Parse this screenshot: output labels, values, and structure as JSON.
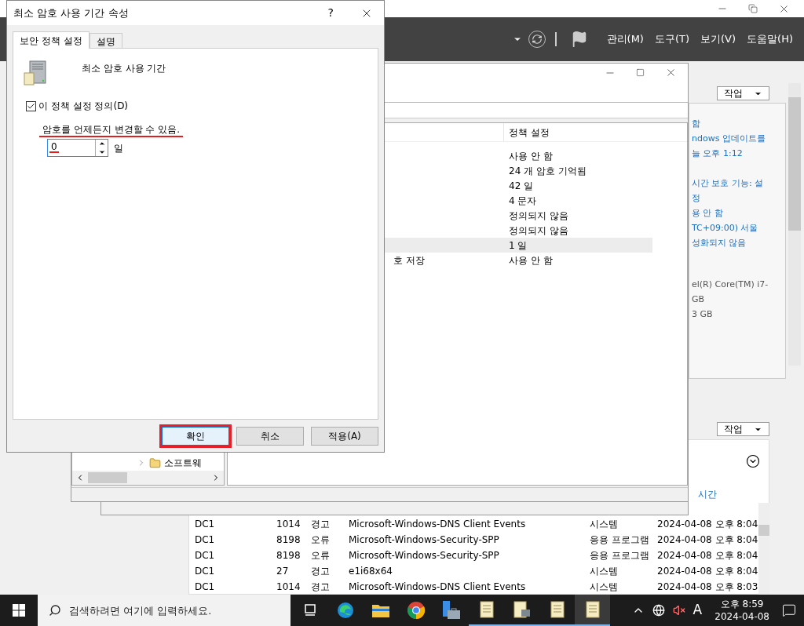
{
  "server_manager": {
    "menus": [
      "관리(M)",
      "도구(T)",
      "보기(V)",
      "도움말(H)"
    ],
    "properties_panel": {
      "task_button": "작업",
      "link_groups": [
        [
          "함",
          "ndows 업데이트를",
          "늘 오후 1:12"
        ],
        [
          "시간 보호 기능: 설",
          "정",
          "용 안 함",
          "TC+09:00) 서울",
          "성화되지 않음"
        ]
      ],
      "details": [
        "el(R) Core(TM) i7-",
        "GB",
        "3 GB"
      ]
    },
    "events_panel": {
      "task_button": "작업",
      "column_header": "시간",
      "rows": [
        {
          "server": "DC1",
          "id": "1014",
          "level": "경고",
          "source": "Microsoft-Windows-DNS Client Events",
          "log": "시스템",
          "date": "2024-04-08 오후 8:04"
        },
        {
          "server": "DC1",
          "id": "8198",
          "level": "오류",
          "source": "Microsoft-Windows-Security-SPP",
          "log": "응용 프로그램",
          "date": "2024-04-08 오후 8:04"
        },
        {
          "server": "DC1",
          "id": "8198",
          "level": "오류",
          "source": "Microsoft-Windows-Security-SPP",
          "log": "응용 프로그램",
          "date": "2024-04-08 오후 8:04"
        },
        {
          "server": "DC1",
          "id": "27",
          "level": "경고",
          "source": "e1i68x64",
          "log": "시스템",
          "date": "2024-04-08 오후 8:04"
        },
        {
          "server": "DC1",
          "id": "1014",
          "level": "경고",
          "source": "Microsoft-Windows-DNS Client Events",
          "log": "시스템",
          "date": "2024-04-08 오후 8:03"
        }
      ]
    }
  },
  "policy_window": {
    "tree_items": [
      {
        "label": "소프트웨",
        "expanded": false
      }
    ],
    "column_header": "정책 설정",
    "rows": [
      {
        "setting": "사용 안 함",
        "selected": false
      },
      {
        "setting": "24 개 암호 기억됨",
        "selected": false
      },
      {
        "setting": "42 일",
        "selected": false
      },
      {
        "setting": "4 문자",
        "selected": false
      },
      {
        "setting": "정의되지 않음",
        "selected": false
      },
      {
        "setting": "정의되지 않음",
        "selected": false
      },
      {
        "setting": "1 일",
        "selected": true
      },
      {
        "name": "호 저장",
        "setting": "사용 안 함",
        "selected": false
      }
    ]
  },
  "dialog": {
    "title": "최소 암호 사용 기간 속성",
    "help": "?",
    "tabs": [
      {
        "label": "보안 정책 설정",
        "selected": true
      },
      {
        "label": "설명",
        "selected": false
      }
    ],
    "policy_name": "최소 암호 사용 기간",
    "define_checkbox": {
      "label": "이 정책 설정 정의(D)",
      "checked": true
    },
    "description": {
      "text": "암호를 언제든지 변경할 수 있음.",
      "underlined": true
    },
    "value_field": {
      "value": "0",
      "underlined": true
    },
    "unit": "일",
    "buttons": [
      {
        "label": "확인",
        "default": true,
        "highlighted": true
      },
      {
        "label": "취소",
        "default": false,
        "highlighted": false
      },
      {
        "label": "적용(A)",
        "default": false,
        "highlighted": false
      }
    ]
  },
  "taskbar": {
    "search": {
      "placeholder": "검색하려면 여기에 입력하세요."
    },
    "apps": [
      {
        "kind": "taskview",
        "running": false,
        "active": false
      },
      {
        "kind": "edge",
        "running": false,
        "active": false
      },
      {
        "kind": "explorer",
        "running": false,
        "active": false
      },
      {
        "kind": "chrome",
        "running": false,
        "active": false
      },
      {
        "kind": "server",
        "running": false,
        "active": false
      },
      {
        "kind": "doc",
        "running": true,
        "active": false
      },
      {
        "kind": "doctool",
        "running": true,
        "active": false
      },
      {
        "kind": "doc",
        "running": true,
        "active": false
      },
      {
        "kind": "doc",
        "running": true,
        "active": true
      }
    ],
    "input_indicator": "A",
    "clock": {
      "time": "오후 8:59",
      "date": "2024-04-08"
    }
  }
}
